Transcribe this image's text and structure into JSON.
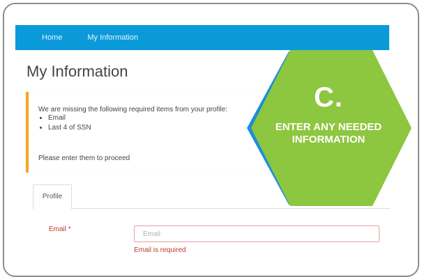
{
  "nav": {
    "items": [
      {
        "label": "Home"
      },
      {
        "label": "My Information"
      }
    ],
    "color": "#0a9ad9"
  },
  "page": {
    "title": "My Information"
  },
  "alert": {
    "message": "We are missing the following required items from your profile:",
    "items": [
      "Email",
      "Last 4 of SSN"
    ],
    "footer": "Please enter them to proceed",
    "accent_color": "#f5a623"
  },
  "tabs": [
    {
      "label": "Profile",
      "active": true
    }
  ],
  "form": {
    "email": {
      "label": "Email",
      "required_marker": "*",
      "placeholder": "Email",
      "value": "",
      "error": "Email is required"
    }
  },
  "callout": {
    "letter": "C.",
    "line1": "ENTER ANY NEEDED",
    "line2": "INFORMATION",
    "fill_color": "#8dc63f",
    "border_color": "#1a8fd6"
  }
}
